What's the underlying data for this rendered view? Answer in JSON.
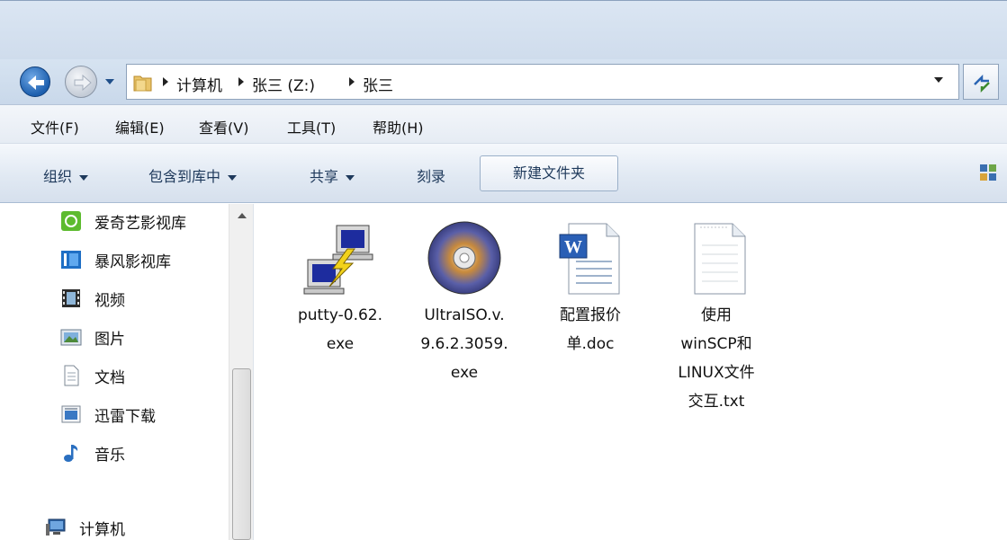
{
  "breadcrumb": [
    "计算机",
    "张三 (Z:)",
    "张三"
  ],
  "menu": [
    "文件(F)",
    "编辑(E)",
    "查看(V)",
    "工具(T)",
    "帮助(H)"
  ],
  "toolbar": {
    "organize": "组织",
    "include_library": "包含到库中",
    "share": "共享",
    "burn": "刻录",
    "new_folder": "新建文件夹"
  },
  "nav": {
    "items": [
      "爱奇艺影视库",
      "暴风影视库",
      "视频",
      "图片",
      "文档",
      "迅雷下载",
      "音乐"
    ],
    "computer": "计算机"
  },
  "files": [
    {
      "name": "putty-0.62.exe",
      "lines": [
        "putty-0.62.",
        "exe"
      ],
      "icon": "putty-icon"
    },
    {
      "name": "UltraISO.v.9.6.2.3059.exe",
      "lines": [
        "UltraISO.v.",
        "9.6.2.3059.",
        "exe"
      ],
      "icon": "disc-icon"
    },
    {
      "name": "配置报价单.doc",
      "lines": [
        "配置报价",
        "单.doc"
      ],
      "icon": "word-doc-icon"
    },
    {
      "name": "使用winSCP和LINUX文件交互.txt",
      "lines": [
        "使用",
        "winSCP和",
        "LINUX文件",
        "交互.txt"
      ],
      "icon": "text-file-icon"
    }
  ]
}
